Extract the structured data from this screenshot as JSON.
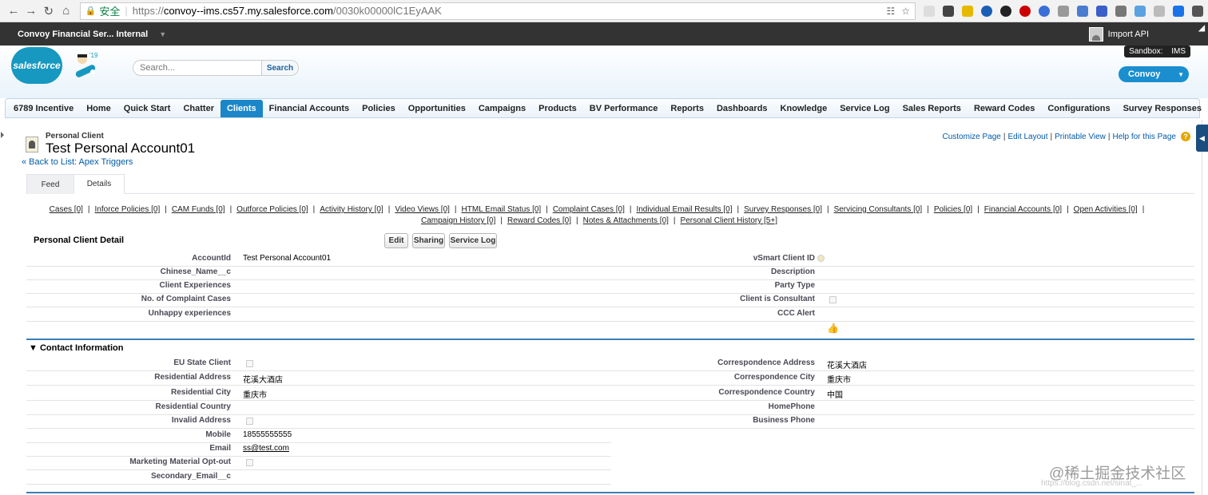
{
  "browser": {
    "url_secure_label": "安全",
    "url_scheme": "https://",
    "url_host": "convoy--ims.cs57.my.salesforce.com",
    "url_path": "/0030k00000lC1EyAAK"
  },
  "topbar": {
    "org_name": "Convoy Financial Ser... Internal",
    "user_label": "Import API"
  },
  "header": {
    "logo_text": "salesforce",
    "mascot_badge": "'19",
    "search_placeholder": "Search...",
    "search_button": "Search",
    "sandbox_label": "Sandbox:",
    "sandbox_name": "IMS",
    "app_menu": "Convoy"
  },
  "tabs": [
    {
      "label": "6789 Incentive"
    },
    {
      "label": "Home"
    },
    {
      "label": "Quick Start"
    },
    {
      "label": "Chatter"
    },
    {
      "label": "Clients",
      "active": true
    },
    {
      "label": "Financial Accounts"
    },
    {
      "label": "Policies"
    },
    {
      "label": "Opportunities"
    },
    {
      "label": "Campaigns"
    },
    {
      "label": "Products"
    },
    {
      "label": "BV Performance"
    },
    {
      "label": "Reports"
    },
    {
      "label": "Dashboards"
    },
    {
      "label": "Knowledge"
    },
    {
      "label": "Service Log"
    },
    {
      "label": "Sales Reports"
    },
    {
      "label": "Reward Codes"
    },
    {
      "label": "Configurations"
    },
    {
      "label": "Survey Responses"
    },
    {
      "label": "+"
    }
  ],
  "record": {
    "type": "Personal Client",
    "name": "Test Personal Account01",
    "back_link": "« Back to List: Apex Triggers"
  },
  "page_links": {
    "customize": "Customize Page",
    "edit_layout": "Edit Layout",
    "printable": "Printable View",
    "help": "Help for this Page"
  },
  "subtabs": {
    "feed": "Feed",
    "details": "Details"
  },
  "related_links": [
    "Cases [0]",
    "Inforce Policies [0]",
    "CAM Funds [0]",
    "Outforce Policies [0]",
    "Activity History [0]",
    "Video Views [0]",
    "HTML Email Status [0]",
    "Complaint Cases [0]",
    "Individual Email Results [0]",
    "Survey Responses [0]",
    "Servicing Consultants [0]",
    "Policies [0]",
    "Financial Accounts [0]",
    "Open Activities [0]",
    "Campaign History [0]",
    "Reward Codes [0]",
    "Notes & Attachments [0]",
    "Personal Client History [5+]"
  ],
  "detail": {
    "title": "Personal Client Detail",
    "buttons": {
      "edit": "Edit",
      "sharing": "Sharing",
      "service_log": "Service Log"
    },
    "left_fields": [
      {
        "label": "AccountId",
        "value": "Test Personal Account01"
      },
      {
        "label": "Chinese_Name__c",
        "value": ""
      },
      {
        "label": "Client Experiences",
        "value": ""
      },
      {
        "label": "No. of Complaint Cases",
        "value": ""
      },
      {
        "label": "Unhappy experiences",
        "value": ""
      }
    ],
    "right_fields": [
      {
        "label": "vSmart Client ID",
        "value": ""
      },
      {
        "label": "Description",
        "value": ""
      },
      {
        "label": "Party Type",
        "value": ""
      },
      {
        "label": "Client is Consultant",
        "value": ""
      },
      {
        "label": "CCC Alert",
        "value": ""
      }
    ]
  },
  "contact": {
    "title": "Contact Information",
    "left_fields": [
      {
        "label": "EU State Client",
        "value": ""
      },
      {
        "label": "Residential Address",
        "value": "花溪大酒店"
      },
      {
        "label": "Residential City",
        "value": "重庆市"
      },
      {
        "label": "Residential Country",
        "value": ""
      },
      {
        "label": "Invalid Address",
        "value": ""
      },
      {
        "label": "Mobile",
        "value": "18555555555"
      },
      {
        "label": "Email",
        "value": "ss@test.com"
      },
      {
        "label": "Marketing Material Opt-out",
        "value": ""
      },
      {
        "label": "Secondary_Email__c",
        "value": ""
      }
    ],
    "right_fields": [
      {
        "label": "Correspondence Address",
        "value": "花溪大酒店"
      },
      {
        "label": "Correspondence City",
        "value": "重庆市"
      },
      {
        "label": "Correspondence Country",
        "value": "中国"
      },
      {
        "label": "HomePhone",
        "value": ""
      },
      {
        "label": "Business Phone",
        "value": ""
      }
    ]
  },
  "watermark": {
    "main": "@稀土掘金技术社区",
    "sub": "https://blog.csdn.net/sinat_..."
  }
}
